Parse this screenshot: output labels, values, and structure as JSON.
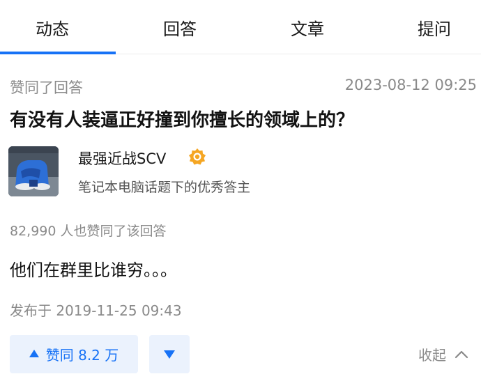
{
  "tabs": [
    {
      "label": "动态",
      "active": true
    },
    {
      "label": "回答"
    },
    {
      "label": "文章"
    },
    {
      "label": "提问"
    }
  ],
  "feed_item": {
    "action": "赞同了回答",
    "action_time": "2023-08-12 09:25",
    "question_title": "有没有人装逼正好撞到你擅长的领域上的？",
    "author": {
      "name": "最强近战SCV",
      "badge_icon": "excellent-answerer-badge-icon",
      "description": "笔记本电脑话题下的优秀答主"
    },
    "agree_text": "82,990 人也赞同了该回答",
    "content": "他们在群里比谁穷。。。",
    "publish_time": "发布于 2019-11-25 09:43",
    "actions": {
      "vote_up_label": "赞同 8.2 万",
      "collapse_label": "收起"
    }
  },
  "colors": {
    "accent": "#1772f6",
    "vote_bg": "#ebf2fd",
    "badge": "#f5a623",
    "meta_text": "#8a8a8a"
  }
}
